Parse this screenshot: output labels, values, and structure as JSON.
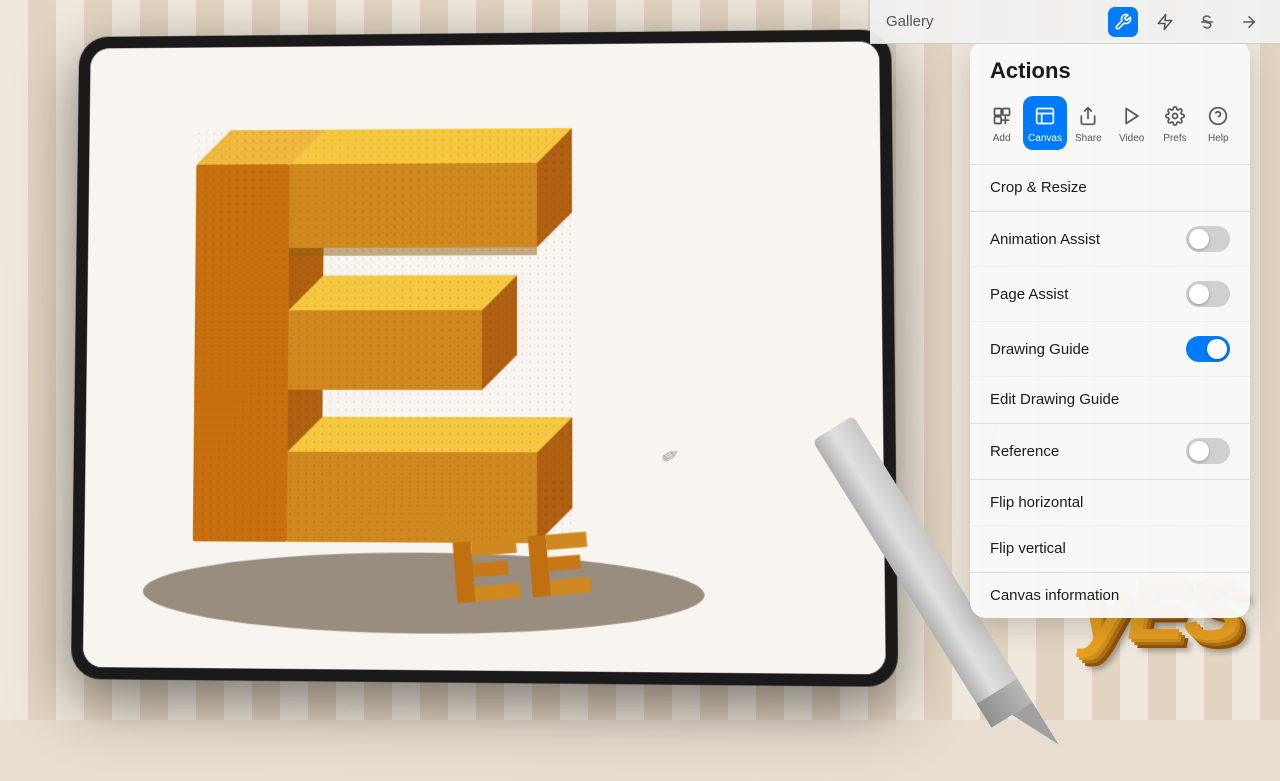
{
  "topBar": {
    "gallery_label": "Gallery",
    "icons": [
      "wrench",
      "lightning",
      "strikethrough",
      "arrow"
    ]
  },
  "panel": {
    "title": "Actions",
    "tools": [
      {
        "id": "add",
        "label": "Add",
        "icon": "＋",
        "active": false
      },
      {
        "id": "canvas",
        "label": "Canvas",
        "icon": "⊞",
        "active": true
      },
      {
        "id": "share",
        "label": "Share",
        "icon": "↑",
        "active": false
      },
      {
        "id": "video",
        "label": "Video",
        "icon": "▶",
        "active": false
      },
      {
        "id": "prefs",
        "label": "Prefs",
        "icon": "◉",
        "active": false
      },
      {
        "id": "help",
        "label": "Help",
        "icon": "?",
        "active": false
      }
    ],
    "rows": [
      {
        "id": "crop-resize",
        "label": "Crop & Resize",
        "hasToggle": false,
        "toggleOn": false
      },
      {
        "id": "animation-assist",
        "label": "Animation Assist",
        "hasToggle": true,
        "toggleOn": false
      },
      {
        "id": "page-assist",
        "label": "Page Assist",
        "hasToggle": true,
        "toggleOn": false
      },
      {
        "id": "drawing-guide",
        "label": "Drawing Guide",
        "hasToggle": true,
        "toggleOn": true
      },
      {
        "id": "edit-drawing-guide",
        "label": "Edit Drawing Guide",
        "hasToggle": false,
        "toggleOn": false
      },
      {
        "id": "reference",
        "label": "Reference",
        "hasToggle": true,
        "toggleOn": false
      },
      {
        "id": "flip-horizontal",
        "label": "Flip horizontal",
        "hasToggle": false,
        "toggleOn": false
      },
      {
        "id": "flip-vertical",
        "label": "Flip vertical",
        "hasToggle": false,
        "toggleOn": false
      },
      {
        "id": "canvas-information",
        "label": "Canvas information",
        "hasToggle": false,
        "toggleOn": false
      }
    ]
  },
  "art": {
    "yes_label": "yES",
    "small_e_label": "ξE"
  }
}
